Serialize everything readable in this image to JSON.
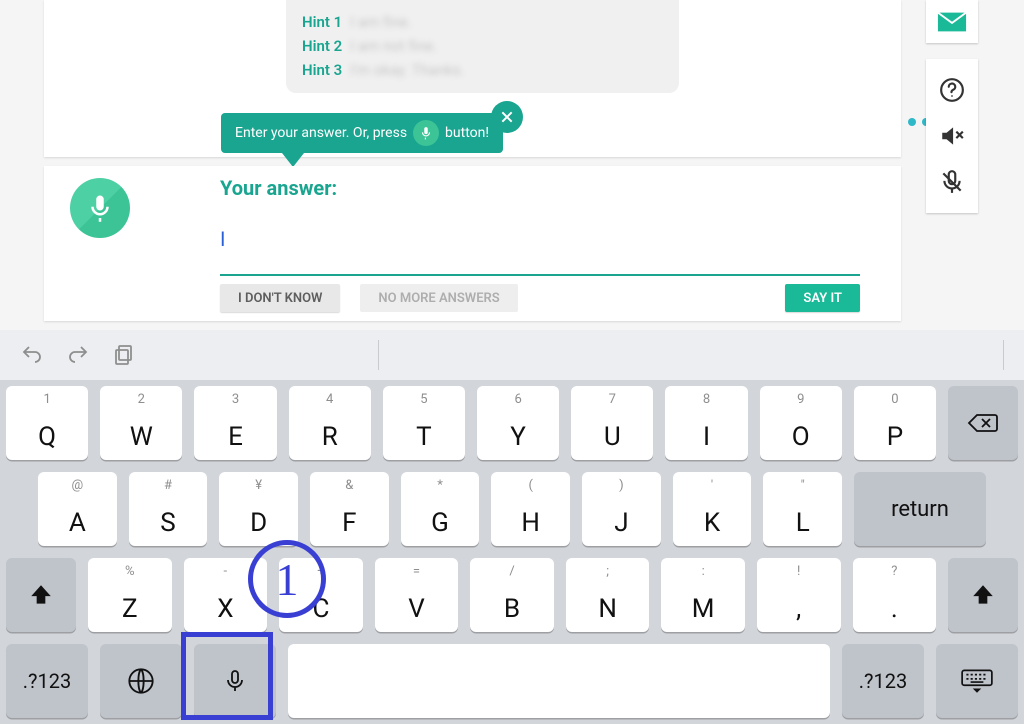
{
  "hints": {
    "label1": "Hint 1",
    "text1": "I am fine.",
    "label2": "Hint 2",
    "text2": "I am not fine.",
    "label3": "Hint 3",
    "text3": "I'm okay. Thanks."
  },
  "tooltip": {
    "pre": "Enter your answer. Or, press",
    "post": "button!"
  },
  "answer": {
    "label": "Your answer:",
    "value": "I"
  },
  "buttons": {
    "idk": "I DON'T KNOW",
    "nomore": "NO MORE ANSWERS",
    "say": "SAY IT"
  },
  "keyboard": {
    "row1": [
      {
        "m": "Q",
        "s": "1"
      },
      {
        "m": "W",
        "s": "2"
      },
      {
        "m": "E",
        "s": "3"
      },
      {
        "m": "R",
        "s": "4"
      },
      {
        "m": "T",
        "s": "5"
      },
      {
        "m": "Y",
        "s": "6"
      },
      {
        "m": "U",
        "s": "7"
      },
      {
        "m": "I",
        "s": "8"
      },
      {
        "m": "O",
        "s": "9"
      },
      {
        "m": "P",
        "s": "0"
      }
    ],
    "row2": [
      {
        "m": "A",
        "s": "@"
      },
      {
        "m": "S",
        "s": "#"
      },
      {
        "m": "D",
        "s": "¥"
      },
      {
        "m": "F",
        "s": "&"
      },
      {
        "m": "G",
        "s": "*"
      },
      {
        "m": "H",
        "s": "("
      },
      {
        "m": "J",
        "s": ")"
      },
      {
        "m": "K",
        "s": "'"
      },
      {
        "m": "L",
        "s": "\""
      }
    ],
    "row3": [
      {
        "m": "Z",
        "s": "%"
      },
      {
        "m": "X",
        "s": "-"
      },
      {
        "m": "C",
        "s": "+"
      },
      {
        "m": "V",
        "s": "="
      },
      {
        "m": "B",
        "s": "/"
      },
      {
        "m": "N",
        "s": ";"
      },
      {
        "m": "M",
        "s": ":"
      },
      {
        "m": ",",
        "s": "!"
      },
      {
        "m": ".",
        "s": "?"
      }
    ],
    "numswitch": ".?123",
    "return": "return"
  },
  "annotation": {
    "number": "1"
  }
}
